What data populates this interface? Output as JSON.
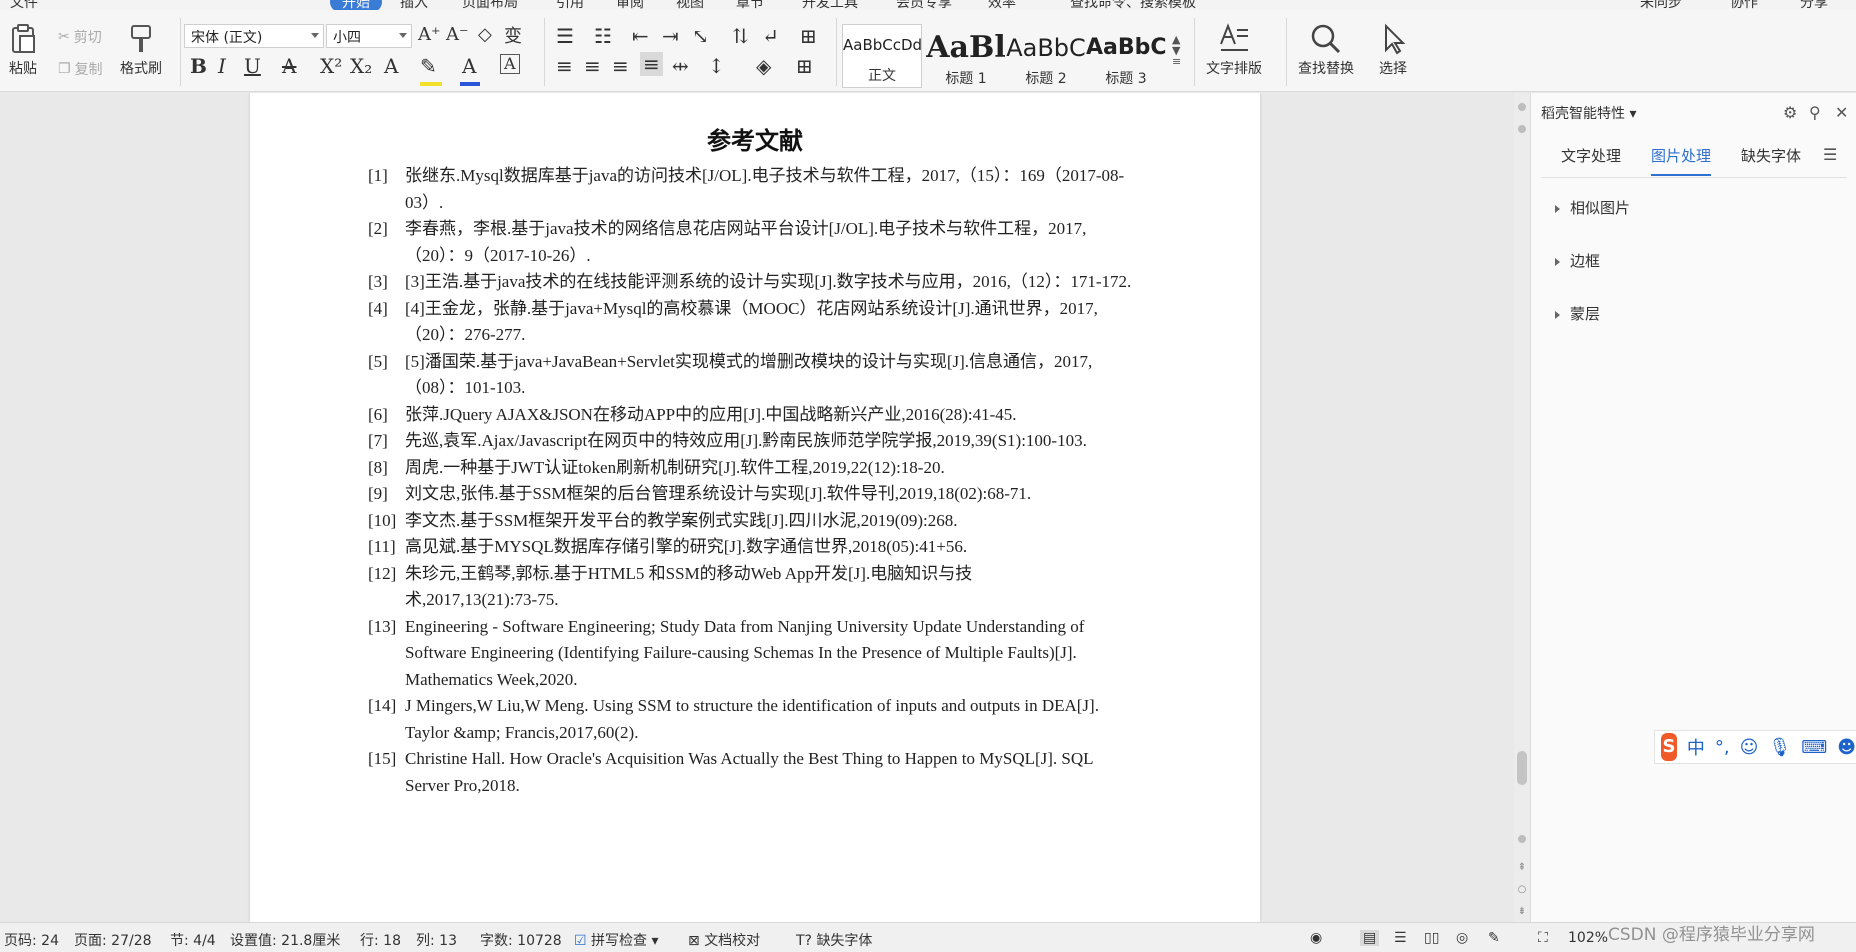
{
  "menu": {
    "file_label": "文件",
    "tabs": [
      "开始",
      "插入",
      "页面布局",
      "引用",
      "审阅",
      "视图",
      "章节",
      "开发工具",
      "会员专享",
      "效率"
    ],
    "search_label": "查找命令、搜索模板",
    "sync_label": "未同步",
    "collab_label": "协作",
    "share_label": "分享"
  },
  "ribbon": {
    "paste": "粘贴",
    "cut": "剪切",
    "copy": "复制",
    "format_painter": "格式刷",
    "font_name": "宋体 (正文)",
    "font_size": "小四",
    "styles": [
      {
        "sample": "AaBbCcDd",
        "label": "正文"
      },
      {
        "sample": "AaBl",
        "label": "标题 1"
      },
      {
        "sample": "AaBbC",
        "label": "标题 2"
      },
      {
        "sample": "AaBbC",
        "label": "标题 3"
      }
    ],
    "text_layout": "文字排版",
    "find_replace": "查找替换",
    "select": "选择"
  },
  "document": {
    "title": "参考文献",
    "references": [
      {
        "num": "[1]",
        "text": "张继东.Mysql数据库基于java的访问技术[J/OL].电子技术与软件工程，2017,（15）：169（2017-08-03）."
      },
      {
        "num": "[2]",
        "text": "李春燕，李根.基于java技术的网络信息花店网站平台设计[J/OL].电子技术与软件工程，2017,（20）：9（2017-10-26）."
      },
      {
        "num": "[3]",
        "text": "[3]王浩.基于java技术的在线技能评测系统的设计与实现[J].数字技术与应用，2016,（12）：171-172."
      },
      {
        "num": "[4]",
        "text": "[4]王金龙，张静.基于java+Mysql的高校慕课（MOOC）花店网站系统设计[J].通讯世界，2017,（20）：276-277."
      },
      {
        "num": "[5]",
        "text": "[5]潘国荣.基于java+JavaBean+Servlet实现模式的增删改模块的设计与实现[J].信息通信，2017,（08）：101-103."
      },
      {
        "num": "[6]",
        "text": "张萍.JQuery AJAX&JSON在移动APP中的应用[J].中国战略新兴产业,2016(28):41-45."
      },
      {
        "num": "[7]",
        "text": "先巡,袁军.Ajax/Javascript在网页中的特效应用[J].黔南民族师范学院学报,2019,39(S1):100-103."
      },
      {
        "num": "[8]",
        "text": "周虎.一种基于JWT认证token刷新机制研究[J].软件工程,2019,22(12):18-20."
      },
      {
        "num": "[9]",
        "text": "刘文忠,张伟.基于SSM框架的后台管理系统设计与实现[J].软件导刊,2019,18(02):68-71."
      },
      {
        "num": "[10]",
        "text": "李文杰.基于SSM框架开发平台的教学案例式实践[J].四川水泥,2019(09):268."
      },
      {
        "num": "[11]",
        "text": "高见斌.基于MYSQL数据库存储引擎的研究[J].数字通信世界,2018(05):41+56."
      },
      {
        "num": "[12]",
        "text": "朱珍元,王鹤琴,郭标.基于HTML5 和SSM的移动Web App开发[J].电脑知识与技术,2017,13(21):73-75."
      },
      {
        "num": "[13]",
        "text": "Engineering - Software Engineering; Study Data from Nanjing University Update Understanding of Software Engineering (Identifying Failure-causing Schemas In the Presence of Multiple Faults)[J]. Mathematics Week,2020."
      },
      {
        "num": "[14]",
        "text": "J Mingers,W Liu,W Meng. Using SSM to structure the identification of inputs and outputs in DEA[J]. Taylor &amp; Francis,2017,60(2)."
      },
      {
        "num": "[15]",
        "text": "Christine Hall. How Oracle's Acquisition Was Actually the Best Thing to Happen to MySQL[J]. SQL Server Pro,2018."
      }
    ]
  },
  "taskpane": {
    "title": "稻壳智能特性",
    "tabs": [
      "文字处理",
      "图片处理",
      "缺失字体"
    ],
    "active_tab": "图片处理",
    "sections": [
      "相似图片",
      "边框",
      "蒙层"
    ]
  },
  "ime": {
    "lang": "中"
  },
  "statusbar": {
    "page_code": "页码: 24",
    "page": "页面: 27/28",
    "section": "节: 4/4",
    "setting": "设置值: 21.8厘米",
    "row": "行: 18",
    "col": "列: 13",
    "word_count": "字数: 10728",
    "spell_check": "拼写检查",
    "doc_proof": "文档校对",
    "missing_font": "缺失字体",
    "zoom": "102%"
  },
  "watermark": "CSDN @程序猿毕业分享网",
  "colors": {
    "accent": "#2e6fd0",
    "ime_logo": "#f05a28"
  }
}
